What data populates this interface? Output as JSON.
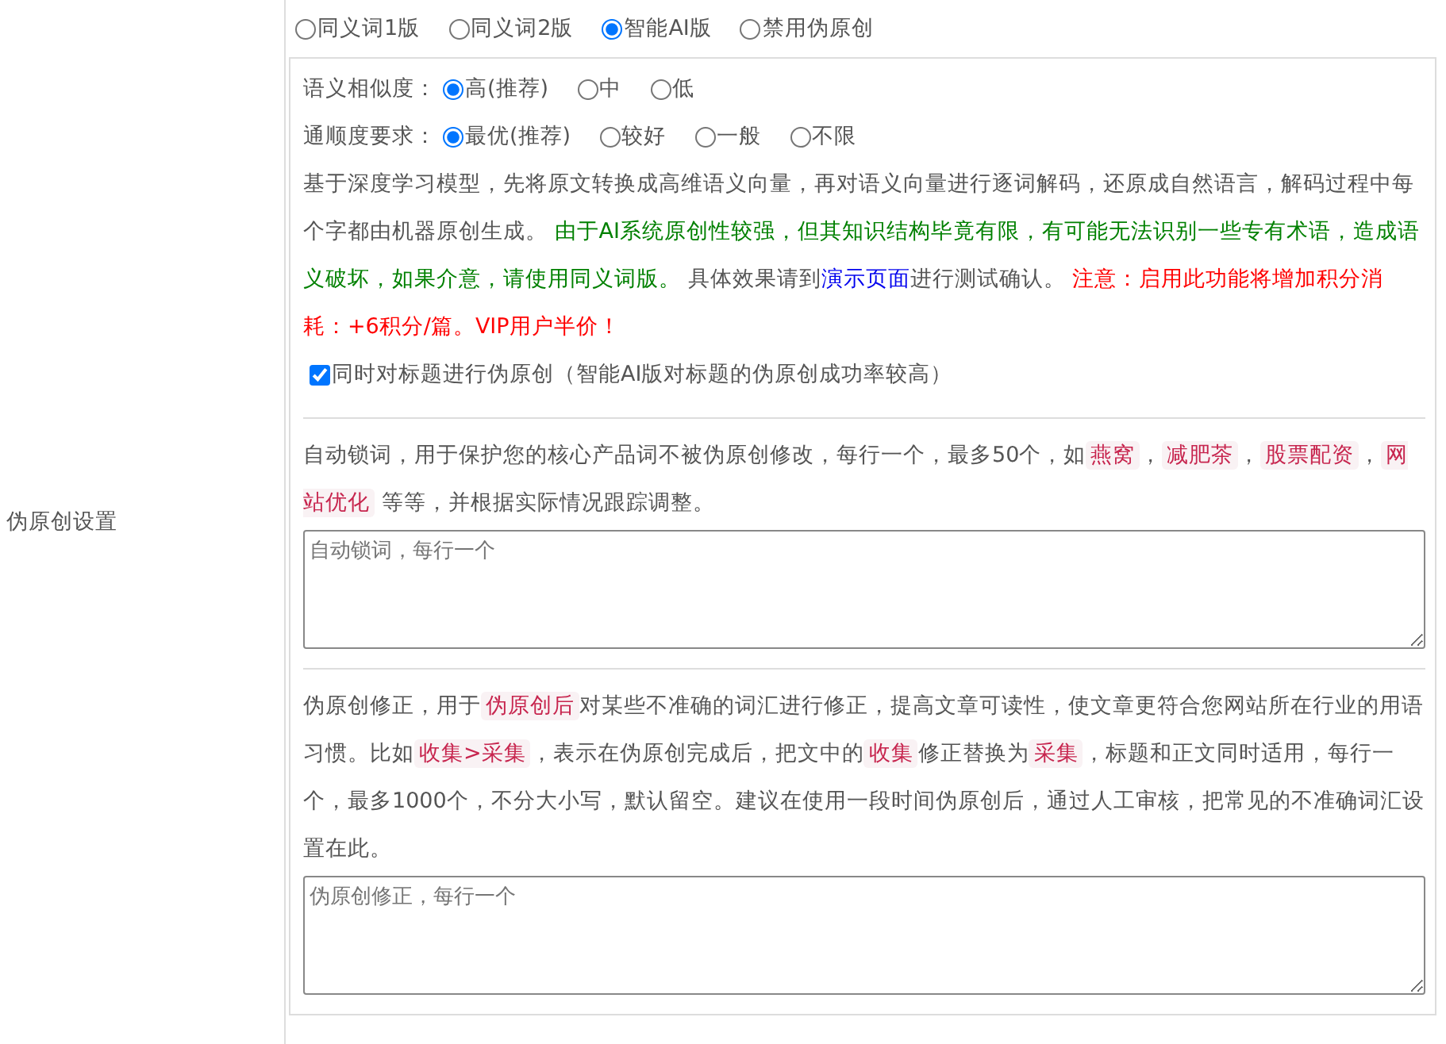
{
  "section_label": "伪原创设置",
  "modes": [
    {
      "label": "同义词1版",
      "selected": false
    },
    {
      "label": "同义词2版",
      "selected": false
    },
    {
      "label": "智能AI版",
      "selected": true
    },
    {
      "label": "禁用伪原创",
      "selected": false
    }
  ],
  "similarity": {
    "label": "语义相似度：",
    "options": [
      {
        "label": "高(推荐)",
        "selected": true
      },
      {
        "label": "中",
        "selected": false
      },
      {
        "label": "低",
        "selected": false
      }
    ]
  },
  "fluency": {
    "label": "通顺度要求：",
    "options": [
      {
        "label": "最优(推荐)",
        "selected": true
      },
      {
        "label": "较好",
        "selected": false
      },
      {
        "label": "一般",
        "selected": false
      },
      {
        "label": "不限",
        "selected": false
      }
    ]
  },
  "description": [
    {
      "kind": "plain",
      "text": "基于深度学习模型，先将原文转换成高维语义向量，再对语义向量进行逐词解码，还原成自然语言，解码过程中每个字都由机器原创生成。 "
    },
    {
      "kind": "notice",
      "text": "由于AI系统原创性较强，但其知识结构毕竟有限，有可能无法识别一些专有术语，造成语义破坏，如果介意，请使用同义词版。"
    },
    {
      "kind": "plain",
      "text": " 具体效果请到"
    },
    {
      "kind": "link",
      "text": "演示页面"
    },
    {
      "kind": "plain",
      "text": "进行测试确认。 "
    },
    {
      "kind": "warning",
      "text": "注意：启用此功能将增加积分消耗：+6积分/篇。VIP用户半价！"
    }
  ],
  "title_option": {
    "label": "同时对标题进行伪原创（智能AI版对标题的伪原创成功率较高）",
    "checked": true
  },
  "lock_words": {
    "help": [
      {
        "kind": "plain",
        "text": "自动锁词，用于保护您的核心产品词不被伪原创修改，每行一个，最多50个，如"
      },
      {
        "kind": "code",
        "text": "燕窝"
      },
      {
        "kind": "plain",
        "text": "，"
      },
      {
        "kind": "code",
        "text": "减肥茶"
      },
      {
        "kind": "plain",
        "text": "，"
      },
      {
        "kind": "code",
        "text": "股票配资"
      },
      {
        "kind": "plain",
        "text": "，"
      },
      {
        "kind": "code",
        "text": "网站优化"
      },
      {
        "kind": "plain",
        "text": " 等等，并根据实际情况跟踪调整。"
      }
    ],
    "placeholder": "自动锁词，每行一个"
  },
  "corrections": {
    "help": [
      {
        "kind": "plain",
        "text": "伪原创修正，用于"
      },
      {
        "kind": "code",
        "text": "伪原创后"
      },
      {
        "kind": "plain",
        "text": "对某些不准确的词汇进行修正，提高文章可读性，使文章更符合您网站所在行业的用语习惯。比如"
      },
      {
        "kind": "code",
        "text": "收集>采集"
      },
      {
        "kind": "plain",
        "text": "，表示在伪原创完成后，把文中的"
      },
      {
        "kind": "code",
        "text": "收集"
      },
      {
        "kind": "plain",
        "text": "修正替换为"
      },
      {
        "kind": "code",
        "text": "采集"
      },
      {
        "kind": "plain",
        "text": "，标题和正文同时适用，每行一个，最多1000个，不分大小写，默认留空。建议在使用一段时间伪原创后，通过人工审核，把常见的不准确词汇设置在此。"
      }
    ],
    "placeholder": "伪原创修正，每行一个"
  }
}
